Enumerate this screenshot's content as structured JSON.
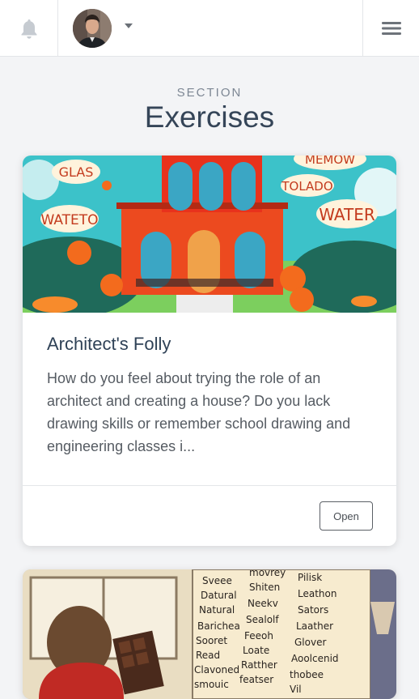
{
  "header": {
    "notifications_icon": "bell-icon",
    "avatar_icon": "user-avatar",
    "dropdown_icon": "caret-down-icon",
    "menu_icon": "hamburger-menu-icon"
  },
  "section": {
    "kicker": "SECTION",
    "title": "Exercises"
  },
  "cards": [
    {
      "image_words": [
        "GLAS",
        "MEMOW",
        "TOLADO",
        "WATETO",
        "WATER"
      ],
      "title": "Architect's Folly",
      "description": "How do you feel about trying the role of an architect and creating a house? Do you lack drawing skills or remember school drawing and engineering classes i...",
      "button_label": "Open"
    },
    {
      "image_words": [
        [
          "movrey",
          "Pilisk"
        ],
        [
          "Sveee",
          "Shiten",
          "Leathon"
        ],
        [
          "Datural",
          "Neekv",
          "Sators"
        ],
        [
          "Natural",
          "Sealolf",
          "Laather"
        ],
        [
          "Baricheа",
          "Feeoh",
          "Glover"
        ],
        [
          "Sooret",
          "Loate",
          "Aoolcenid"
        ],
        [
          "Read",
          "Ratther",
          "thobee"
        ],
        [
          "Clavoned",
          "featser",
          "Vil"
        ],
        [
          "smouic"
        ]
      ]
    }
  ],
  "colors": {
    "background": "#f3f4f6",
    "title": "#354558",
    "card_title": "#2f4257"
  }
}
